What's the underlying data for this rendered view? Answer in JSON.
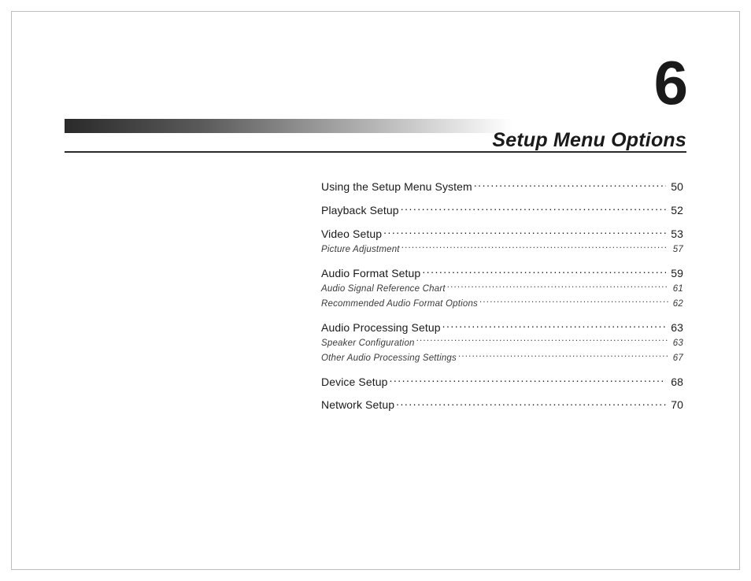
{
  "chapter_number": "6",
  "section_title": "Setup Menu Options",
  "toc": [
    {
      "label": "Using the Setup Menu System",
      "page": "50",
      "sub": false
    },
    {
      "label": "Playback Setup",
      "page": "52",
      "sub": false
    },
    {
      "label": "Video Setup",
      "page": "53",
      "sub": false
    },
    {
      "label": "Picture Adjustment",
      "page": "57",
      "sub": true
    },
    {
      "label": "Audio Format Setup",
      "page": "59",
      "sub": false
    },
    {
      "label": "Audio Signal Reference Chart",
      "page": "61",
      "sub": true
    },
    {
      "label": "Recommended Audio Format Options",
      "page": "62",
      "sub": true
    },
    {
      "label": "Audio Processing Setup",
      "page": "63",
      "sub": false
    },
    {
      "label": "Speaker Configuration",
      "page": "63",
      "sub": true
    },
    {
      "label": "Other Audio Processing Settings",
      "page": "67",
      "sub": true
    },
    {
      "label": "Device Setup",
      "page": "68",
      "sub": false
    },
    {
      "label": "Network Setup",
      "page": "70",
      "sub": false
    }
  ]
}
